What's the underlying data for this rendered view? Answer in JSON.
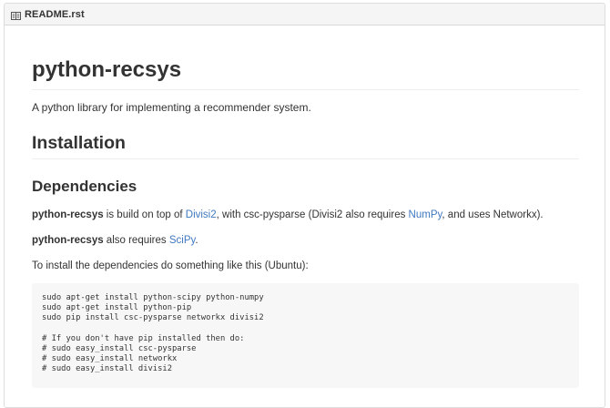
{
  "file_header": {
    "icon": "book-icon",
    "name": "README.rst"
  },
  "readme": {
    "title": "python-recsys",
    "description": "A python library for implementing a recommender system.",
    "section_installation": "Installation",
    "subsection_dependencies": "Dependencies",
    "para1": {
      "strong": "python-recsys",
      "text1": " is build on top of ",
      "link1": "Divisi2",
      "text2": ", with csc-pysparse (Divisi2 also requires ",
      "link2": "NumPy",
      "text3": ", and uses Networkx)."
    },
    "para2": {
      "strong": "python-recsys",
      "text1": " also requires ",
      "link1": "SciPy",
      "text2": "."
    },
    "para3": "To install the dependencies do something like this (Ubuntu):",
    "code_lines": [
      "sudo apt-get install python-scipy python-numpy",
      "sudo apt-get install python-pip",
      "sudo pip install csc-pysparse networkx divisi2",
      "",
      "# If you don't have pip installed then do:",
      "# sudo easy_install csc-pysparse",
      "# sudo easy_install networkx",
      "# sudo easy_install divisi2"
    ]
  },
  "colors": {
    "link": "#4078c0",
    "text": "#333333",
    "code_bg": "#f7f7f7",
    "header_bg": "#f5f5f5"
  }
}
